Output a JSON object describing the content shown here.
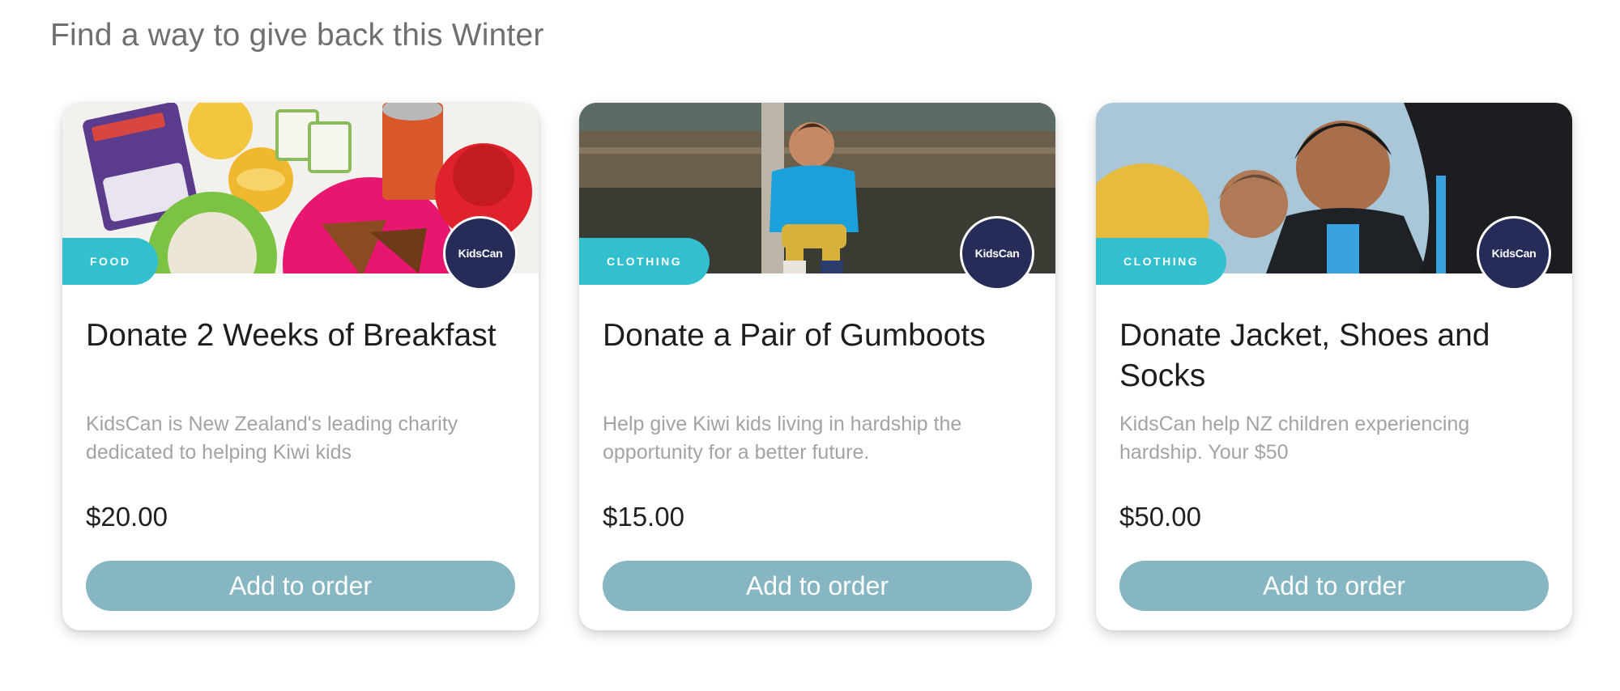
{
  "section": {
    "title": "Find a way to give back this Winter"
  },
  "cards": [
    {
      "category": "FOOD",
      "brand": "KidsCan",
      "title": "Donate 2 Weeks of Breakfast",
      "description": "KidsCan is New Zealand's leading charity dedicated to helping Kiwi kids",
      "price": "$20.00",
      "button_label": "Add to order"
    },
    {
      "category": "CLOTHING",
      "brand": "KidsCan",
      "title": "Donate a Pair of Gumboots",
      "description": "Help give Kiwi kids living in hardship the opportunity for a better future.",
      "price": "$15.00",
      "button_label": "Add to order"
    },
    {
      "category": "CLOTHING",
      "brand": "KidsCan",
      "title": "Donate Jacket, Shoes and Socks",
      "description": "KidsCan help NZ children experiencing hardship. Your $50",
      "price": "$50.00",
      "button_label": "Add to order"
    }
  ],
  "colors": {
    "tag": "#32c0cf",
    "button": "#85b6c1",
    "brand_badge": "#262b58",
    "title_text": "#1d1d1f",
    "description_text": "#a3a3a3"
  }
}
